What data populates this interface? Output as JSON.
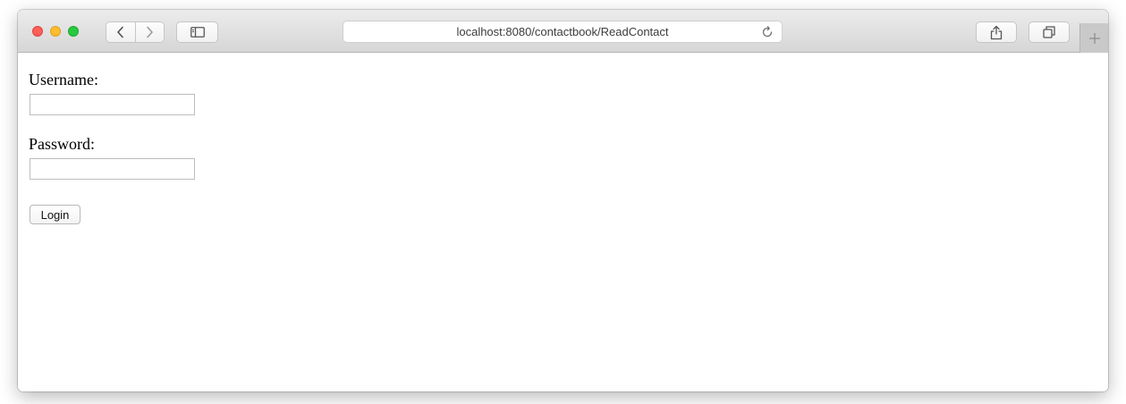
{
  "browser": {
    "url": "localhost:8080/contactbook/ReadContact",
    "icons": {
      "back": "chevron-left-icon",
      "forward": "chevron-right-icon",
      "sidebar": "sidebar-icon",
      "reload": "reload-icon",
      "share": "share-icon",
      "tabs": "tabs-overview-icon",
      "new_tab": "plus-icon"
    }
  },
  "form": {
    "username_label": "Username:",
    "username_value": "",
    "password_label": "Password:",
    "password_value": "",
    "submit_label": "Login"
  },
  "colors": {
    "close": "#fe5f57",
    "minimize": "#febc2e",
    "maximize": "#28c840"
  }
}
